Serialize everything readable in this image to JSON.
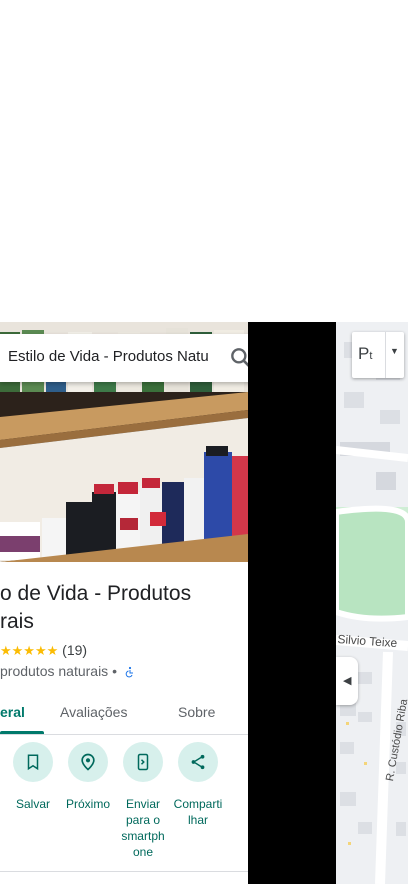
{
  "search": {
    "query": "Estilo de Vida - Produtos Natu"
  },
  "place": {
    "title_line1": "o de Vida - Produtos",
    "title_line2": "rais",
    "stars": "★★★★★",
    "review_count": "(19)",
    "category": "produtos naturais •"
  },
  "tabs": [
    {
      "label": "eral",
      "active": true
    },
    {
      "label": "Avaliações",
      "active": false
    },
    {
      "label": "Sobre",
      "active": false
    }
  ],
  "actions": [
    {
      "label": "Salvar",
      "icon": "bookmark-icon"
    },
    {
      "label": "Próximo",
      "icon": "nearby-icon"
    },
    {
      "label": "Enviar para o smartphone",
      "icon": "send-to-phone-icon"
    },
    {
      "label": "Compartilhar",
      "icon": "share-icon"
    }
  ],
  "map": {
    "layer_button": "P",
    "street_1": "Silvio Teixe",
    "street_2": "R. Custódio Riba"
  },
  "colors": {
    "accent": "#00796b",
    "action_bg": "#d7f0ec",
    "star": "#fbbc04"
  }
}
